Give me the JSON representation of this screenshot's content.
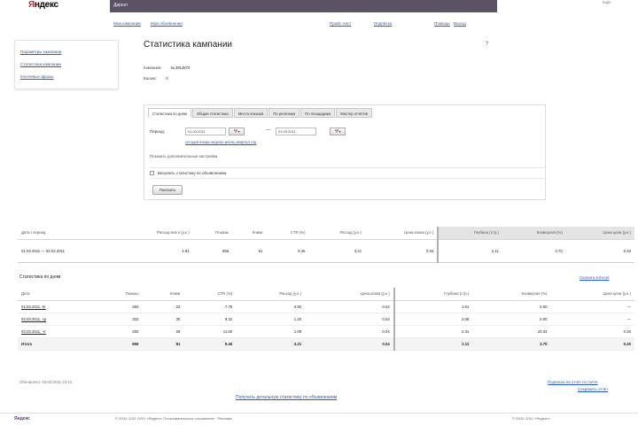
{
  "header": {
    "logo_prefix": "Я",
    "logo_rest": "ндекс",
    "topbar_text": "Директ",
    "user": "login",
    "nav": [
      "Мои кампании",
      "Мои объявления",
      "Прайс-лист",
      "Подписка",
      "Помощь",
      "Выход"
    ]
  },
  "leftbox": {
    "links": [
      "Параметры кампании",
      "Статистика кампании",
      "Ключевые фразы"
    ]
  },
  "page": {
    "title": "Статистика кампании",
    "help": "?",
    "meta": [
      {
        "label": "Кампания:",
        "value": "№ 3914870"
      },
      {
        "label": "Баланс:",
        "value": "0"
      }
    ]
  },
  "filter": {
    "tabs": [
      "Статистика по дням",
      "Общая статистика",
      "Места показов",
      "По регионам",
      "По площадкам",
      "Мастер отчётов"
    ],
    "period_label": "Период:",
    "date_from": "01.03.2011",
    "date_to": "03.03.2011",
    "cal_label": "📅▾",
    "dash": "—",
    "quick_links": "сегодня вчера неделю месяц квартал год",
    "advanced_link": "Показать дополнительные настройки",
    "checkbox_label": "Включить статистику по объявлениям",
    "show_button": "Показать"
  },
  "summary": {
    "headers": [
      "Дата / период",
      "Расход всего (у.е.)",
      "Показы",
      "Клики",
      "CTR (%)",
      "Расход (у.е.)",
      "Цена клика (у.е.)",
      "Глубина (стр.)",
      "Конверсия (%)",
      "Цена цели (у.е.)"
    ],
    "row": [
      "01.03.2011 — 03.03.2011",
      "4.91",
      "856",
      "81",
      "9.46",
      "3.21",
      "0.04",
      "2.11",
      "3.70",
      "0.40"
    ]
  },
  "daily": {
    "title": "Статистика по дням",
    "export": "Скачать в Excel",
    "headers": [
      "Дата",
      "Показы",
      "Клики",
      "CTR (%)",
      "Расход (у.е.)",
      "Цена клика (у.е.)",
      "Глубина (стр.)",
      "Конверсия (%)",
      "Цена цели (у.е.)"
    ],
    "rows": [
      [
        "01.03.2011, вт",
        "284",
        "22",
        "7.75",
        "0.92",
        "0.04",
        "1.91",
        "0.00",
        "—"
      ],
      [
        "02.03.2011, ср",
        "322",
        "30",
        "9.32",
        "1.20",
        "0.04",
        "2.08",
        "0.00",
        "—"
      ],
      [
        "03.03.2011, чт",
        "250",
        "29",
        "11.60",
        "1.09",
        "0.04",
        "2.31",
        "10.34",
        "0.40"
      ]
    ],
    "total": [
      "Итого",
      "856",
      "81",
      "9.46",
      "3.21",
      "0.04",
      "2.11",
      "3.70",
      "0.40"
    ]
  },
  "footer_area": {
    "updated": "Обновлено: 03.03.2011 23:12",
    "sub_link": "Подписка на отчёт по почте",
    "sub_link2": "Сохранить отчёт",
    "bottom_link": "Получить детальную статистику по объявлениям",
    "footer_logo": "Яндекс",
    "footer_text": "© 2000–2011 ООО «Яндекс» Пользовательское соглашение · Реклама",
    "footer_copy": "© 2000–2011 «Яндекс»"
  }
}
